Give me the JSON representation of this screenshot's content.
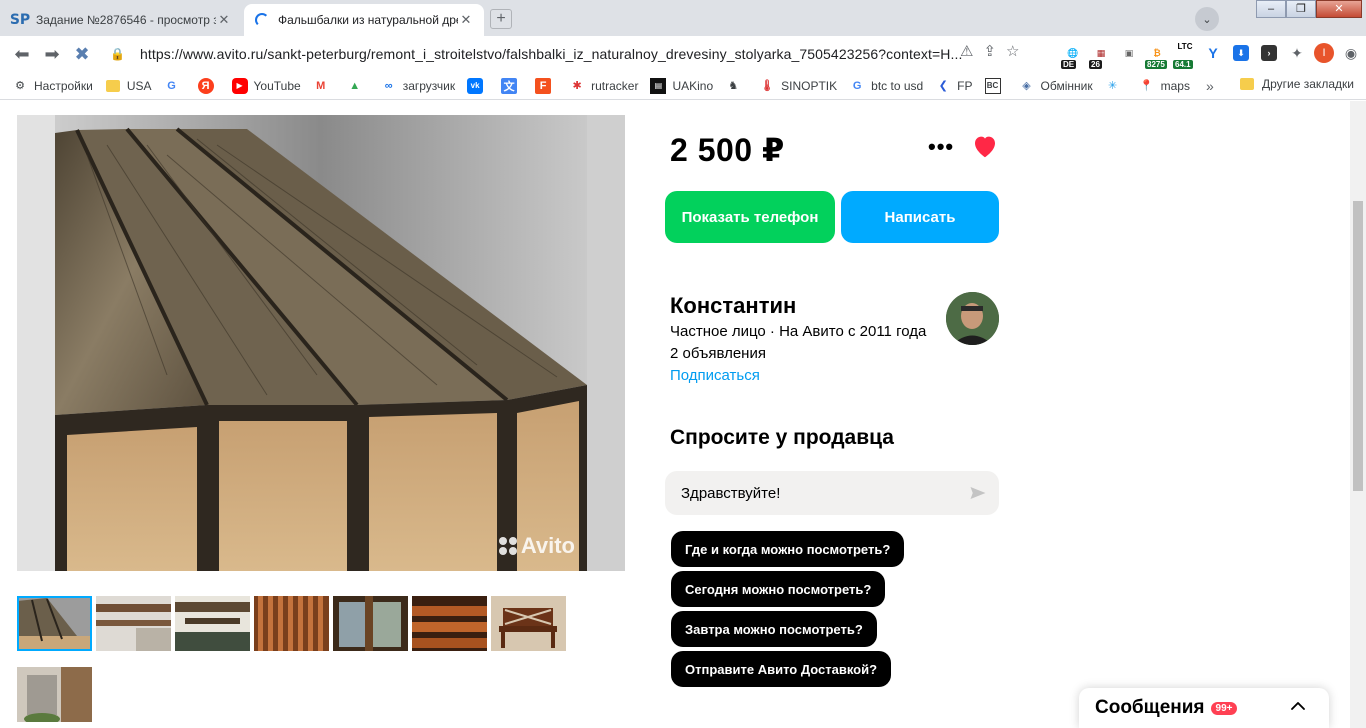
{
  "browser": {
    "tabs": [
      {
        "title": "Задание №2876546 - просмотр з",
        "favicon": "SP",
        "active": false
      },
      {
        "title": "Фальшбалки из натуральной дре",
        "favicon": "loading-spinner",
        "active": true
      }
    ],
    "new_tab_symbol": "+",
    "address": "https://www.avito.ru/sankt-peterburg/remont_i_stroitelstvo/falshbalki_iz_naturalnoy_drevesiny_stolyarka_7505423256?context=H...",
    "extension_badges": {
      "de": "DE",
      "calendar": "26",
      "btc": "8275",
      "ltc_label": "LTC",
      "ltc": "64.1"
    },
    "profile_letter": "I"
  },
  "bookmarks": [
    {
      "label": "Настройки",
      "icon": "gear-icon"
    },
    {
      "label": "USA",
      "icon": "folder-icon"
    },
    {
      "label": "",
      "icon": "google-icon"
    },
    {
      "label": "",
      "icon": "yandex-icon"
    },
    {
      "label": "YouTube",
      "icon": "youtube-icon"
    },
    {
      "label": "",
      "icon": "gmail-icon"
    },
    {
      "label": "",
      "icon": "drive-icon"
    },
    {
      "label": "загрузчик",
      "icon": "infinity-icon"
    },
    {
      "label": "",
      "icon": "vk-icon"
    },
    {
      "label": "",
      "icon": "translate-icon"
    },
    {
      "label": "",
      "icon": "f-icon"
    },
    {
      "label": "rutracker",
      "icon": "rutracker-icon"
    },
    {
      "label": "UAKino",
      "icon": "uakino-icon"
    },
    {
      "label": "",
      "icon": "chess-icon"
    },
    {
      "label": "SINOPTIK",
      "icon": "thermometer-icon"
    },
    {
      "label": "btc to usd",
      "icon": "google-icon"
    },
    {
      "label": "FP",
      "icon": "fp-icon"
    },
    {
      "label": "",
      "icon": "bc-icon"
    },
    {
      "label": "Обмінник",
      "icon": "exchange-icon"
    },
    {
      "label": "",
      "icon": "snowflake-icon"
    },
    {
      "label": "maps",
      "icon": "maps-icon"
    }
  ],
  "bookmarks_more": "»",
  "other_bookmarks": "Другие закладки",
  "listing": {
    "price": "2 500 ₽",
    "more_symbol": "•••",
    "phone_button": "Показать телефон",
    "write_button": "Написать",
    "watermark": "Avito"
  },
  "seller": {
    "name": "Константин",
    "type_line": "Частное лицо · На Авито с 2011 года",
    "ads_count": "2 объявления",
    "subscribe": "Подписаться"
  },
  "ask": {
    "title": "Спросите у продавца",
    "message_value": "Здравствуйте!",
    "quick_questions": [
      "Где и когда можно посмотреть?",
      "Сегодня можно посмотреть?",
      "Завтра можно посмотреть?",
      "Отправите Авито Доставкой?"
    ]
  },
  "messages_widget": {
    "title": "Сообщения",
    "badge": "99+"
  },
  "colors": {
    "green": "#02d15c",
    "blue": "#00aaff",
    "heart": "#ff2846",
    "link": "#009cf0"
  }
}
